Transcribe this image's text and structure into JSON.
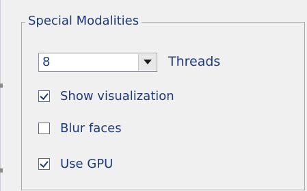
{
  "group": {
    "title": "Special Modalities"
  },
  "threads": {
    "value": "8",
    "label": "Threads"
  },
  "options": {
    "show_visualization": {
      "label": "Show visualization",
      "checked": true
    },
    "blur_faces": {
      "label": "Blur faces",
      "checked": false
    },
    "use_gpu": {
      "label": "Use GPU",
      "checked": true
    }
  }
}
